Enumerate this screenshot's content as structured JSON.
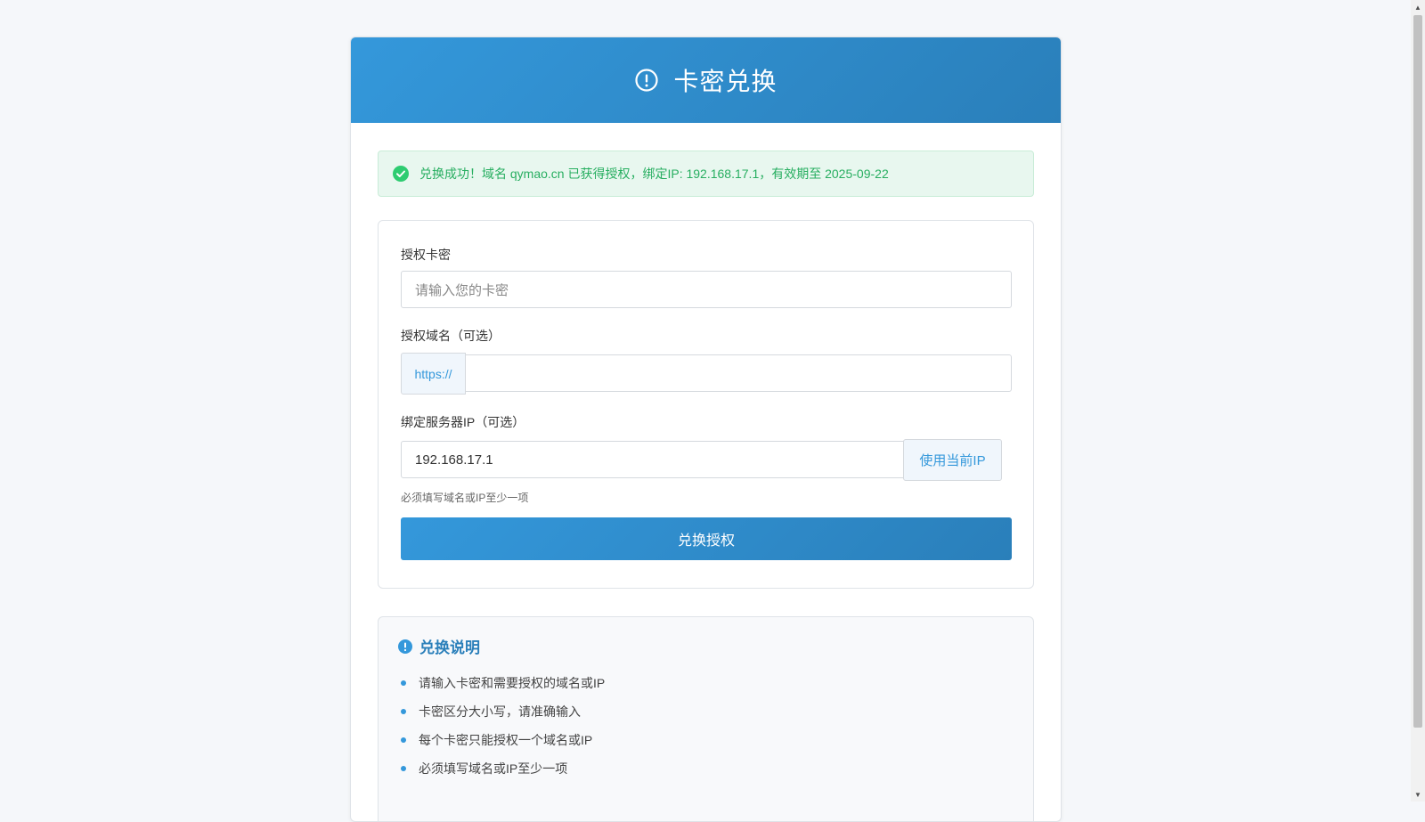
{
  "header": {
    "title": "卡密兑换",
    "icon": "exclamation-circle-icon"
  },
  "alert": {
    "icon": "check-circle-icon",
    "message": "兑换成功！域名 qymao.cn 已获得授权，绑定IP: 192.168.17.1，有效期至 2025-09-22",
    "color": "#27ae60"
  },
  "form": {
    "card_key": {
      "label": "授权卡密",
      "placeholder": "请输入您的卡密",
      "value": ""
    },
    "domain": {
      "label": "授权域名（可选）",
      "prefix": "https://",
      "value": ""
    },
    "ip": {
      "label": "绑定服务器IP（可选）",
      "value": "192.168.17.1",
      "button_label": "使用当前IP"
    },
    "hint": "必须填写域名或IP至少一项",
    "submit_label": "兑换授权"
  },
  "info": {
    "icon": "info-circle-icon",
    "title": "兑换说明",
    "items": [
      "请输入卡密和需要授权的域名或IP",
      "卡密区分大小写，请准确输入",
      "每个卡密只能授权一个域名或IP",
      "必须填写域名或IP至少一项"
    ]
  },
  "colors": {
    "accent": "#3498db",
    "accent_dark": "#2a7fba",
    "success": "#27ae60"
  }
}
